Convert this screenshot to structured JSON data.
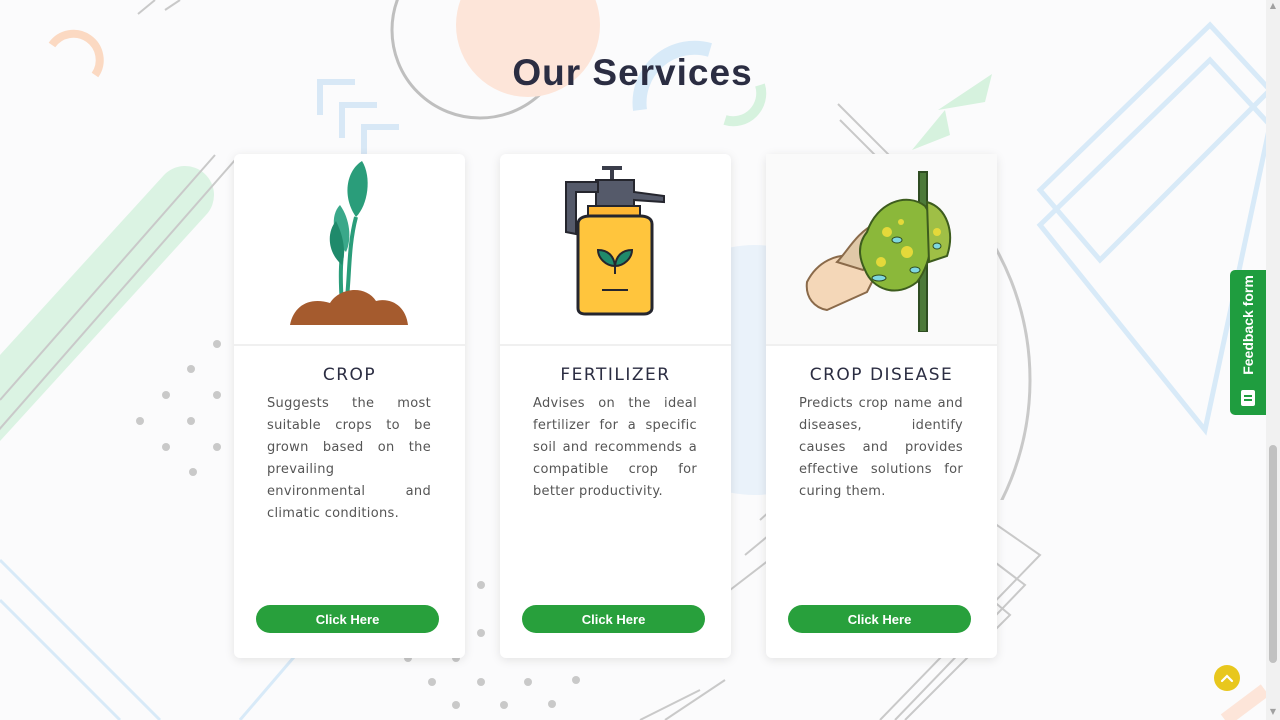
{
  "section": {
    "title": "Our Services"
  },
  "services": [
    {
      "title": "CROP",
      "description": "Suggests the most suitable crops to be grown based on the prevailing environmental and climatic conditions.",
      "button_label": "Click Here",
      "icon": "plant-sprout-icon"
    },
    {
      "title": "FERTILIZER",
      "description": "Advises on the ideal fertilizer for a specific soil and recommends a compatible crop for better productivity.",
      "button_label": "Click Here",
      "icon": "fertilizer-spray-bottle-icon"
    },
    {
      "title": "CROP DISEASE",
      "description": "Predicts crop name and diseases, identify causes and provides effective solutions for curing them.",
      "button_label": "Click Here",
      "icon": "diseased-leaf-icon"
    }
  ],
  "feedback": {
    "label": "Feedback form",
    "icon": "form-icon"
  },
  "back_to_top": {
    "icon": "chevron-up-icon"
  },
  "colors": {
    "button_green": "#28a03c",
    "feedback_green": "#1f9d3f",
    "back_to_top_yellow": "#e8c71d",
    "title_text": "#2b2d42"
  }
}
